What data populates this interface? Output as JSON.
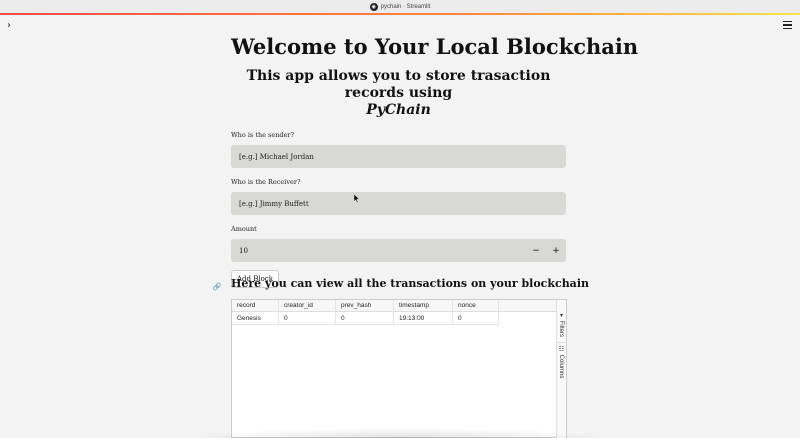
{
  "window": {
    "title": "pychain · Streamlit"
  },
  "header": {
    "sidebar_toggle_icon": "chevron-right-icon",
    "menu_icon": "hamburger-menu-icon"
  },
  "main": {
    "title": "Welcome to Your Local Blockchain",
    "subtitle": "This app allows you to store trasaction records using",
    "subtitle_emphasis": "PyChain",
    "sender": {
      "label": "Who is the sender?",
      "value": "[e.g.] Michael Jordan"
    },
    "receiver": {
      "label": "Who is the Receiver?",
      "value": "[e.g.] Jimmy Buffett"
    },
    "amount": {
      "label": "Amount",
      "value": "10",
      "decrement": "−",
      "increment": "+"
    },
    "add_block_label": "Add Block",
    "section_heading": "Here you can view all the transactions on your blockchain"
  },
  "table": {
    "columns": [
      "record",
      "creator_id",
      "prev_hash",
      "timestamp",
      "nonce"
    ],
    "rows": [
      [
        "Genesis",
        "0",
        "0",
        "19:13:00",
        "0"
      ]
    ],
    "side_tabs": {
      "filters": "Filters",
      "columns": "Columns"
    }
  },
  "colors": {
    "accent_gradient_start": "#ff4b4b",
    "accent_gradient_end": "#ffe34b",
    "input_background": "#d8d8d5",
    "page_background": "#f3f3f3"
  }
}
